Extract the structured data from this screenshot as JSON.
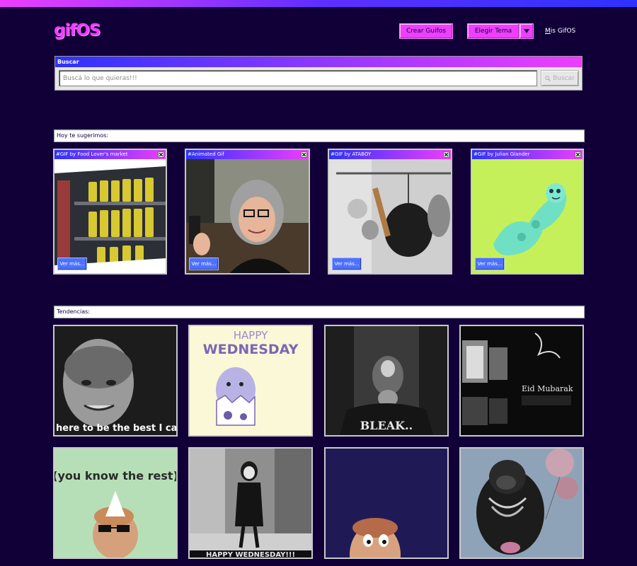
{
  "header": {
    "logo": "gifOS",
    "create_label": "Crear Guifos",
    "theme_label": "Elegir Tema",
    "mygifos_prefix": "M",
    "mygifos_rest": "is GifOS"
  },
  "search": {
    "panel_title": "Buscar",
    "placeholder": "Buscá lo que quieras!!!",
    "button_label": "Buscar"
  },
  "suggestions": {
    "title": "Hoy te sugerimos:",
    "cards": [
      {
        "title": "#GIF by Food Lover's market",
        "button": "Ver más..."
      },
      {
        "title": "#Animated Gif",
        "button": "Ver más..."
      },
      {
        "title": "#GIF by ATABOY",
        "button": "Ver más..."
      },
      {
        "title": "#GIF by Julian Glander",
        "button": "Ver más..."
      }
    ]
  },
  "trending": {
    "title": "Tendencias:",
    "tile_texts": {
      "t1": "here to be the best I ca",
      "t2_line1": "HAPPY",
      "t2_line2": "WEDNESDAY",
      "t3": "BLEAK..",
      "t4": "Eid Mubarak",
      "t5": "(you know the rest)",
      "t6": "HAPPY WEDNESDAY!!!"
    }
  },
  "colors": {
    "background": "#110038",
    "accent_pink": "#ee3efe",
    "accent_blue": "#2e32fb",
    "button_blue": "#4d71ff"
  },
  "icons": {
    "search": "search-icon",
    "close": "close-icon",
    "dropdown": "chevron-down-icon"
  }
}
